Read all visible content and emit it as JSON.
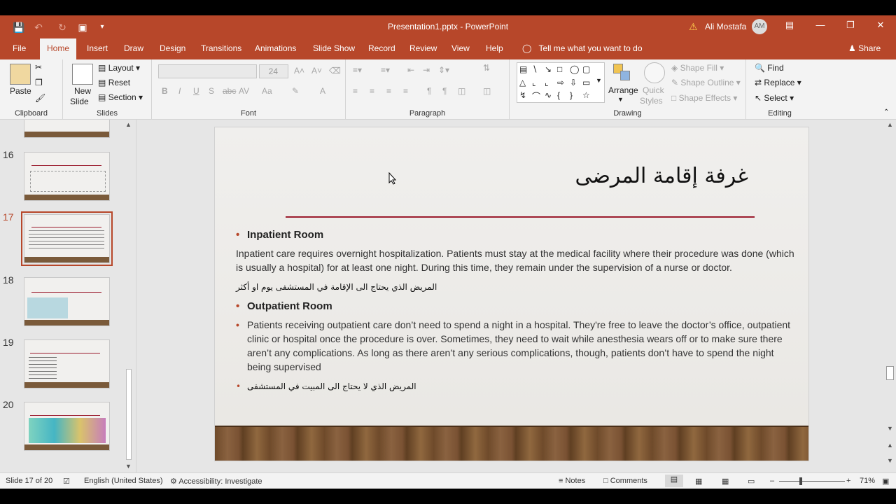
{
  "titlebar": {
    "doc_title": "Presentation1.pptx  -  PowerPoint",
    "user": "Ali Mostafa",
    "avatar_initials": "AM"
  },
  "tabs": [
    "File",
    "Home",
    "Insert",
    "Draw",
    "Design",
    "Transitions",
    "Animations",
    "Slide Show",
    "Record",
    "Review",
    "View",
    "Help"
  ],
  "tell_me": "Tell me what you want to do",
  "share": "Share",
  "ribbon": {
    "clipboard": {
      "label": "Clipboard",
      "paste": "Paste"
    },
    "slides": {
      "label": "Slides",
      "new_slide": "New",
      "new_slide2": "Slide",
      "layout": "Layout",
      "reset": "Reset",
      "section": "Section"
    },
    "font": {
      "label": "Font",
      "size": "24",
      "b": "B",
      "i": "I",
      "u": "U",
      "s": "S",
      "abc": "abc",
      "av": "AV",
      "aa": "Aa",
      "a": "A"
    },
    "paragraph": {
      "label": "Paragraph"
    },
    "drawing": {
      "label": "Drawing",
      "arrange": "Arrange",
      "quick_styles": "Quick",
      "quick_styles2": "Styles",
      "shape_fill": "Shape Fill",
      "shape_outline": "Shape Outline",
      "shape_effects": "Shape Effects"
    },
    "editing": {
      "label": "Editing",
      "find": "Find",
      "replace": "Replace",
      "select": "Select"
    }
  },
  "thumbnails": [
    {
      "num": "16"
    },
    {
      "num": "17"
    },
    {
      "num": "18"
    },
    {
      "num": "19"
    },
    {
      "num": "20"
    }
  ],
  "slide": {
    "title": "غرفة إقامة المرضى",
    "heading1": "Inpatient Room",
    "para1": "Inpatient care requires overnight hospitalization. Patients must stay at the medical facility where their procedure was done (which is usually a hospital) for at least one night. During this time, they remain under the supervision of a nurse or doctor.",
    "ar1": "المريض الذي يحتاج الى الإقامة في المستشفى يوم او أكثر",
    "heading2": "Outpatient Room",
    "para2": "Patients receiving outpatient care don’t need to spend a night in a hospital. They're free to leave the doctor’s office, outpatient clinic or hospital once the procedure is over. Sometimes, they need to wait while anesthesia wears off or to make sure there aren’t any complications. As long as there aren’t any serious complications, though, patients don’t have to spend the night being supervised",
    "ar2": "المريض الذي لا يحتاج الى المبيت في المستشفى"
  },
  "status": {
    "slide_count": "Slide 17 of 20",
    "language": "English (United States)",
    "accessibility": "Accessibility: Investigate",
    "notes": "Notes",
    "comments": "Comments",
    "zoom": "71%"
  },
  "colors": {
    "accent": "#b7472a",
    "title_rule": "#9b1c2e"
  }
}
